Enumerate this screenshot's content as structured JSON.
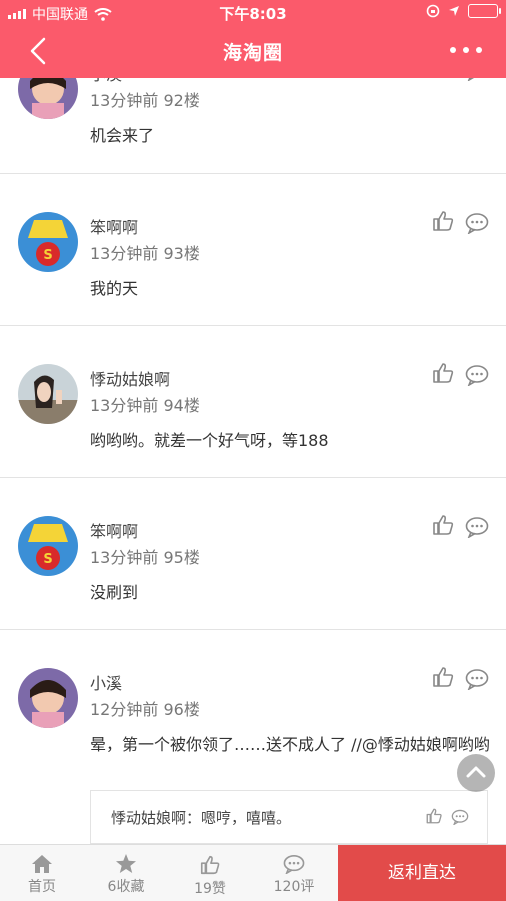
{
  "status_bar": {
    "carrier": "中国联通",
    "time": "下午8:03"
  },
  "nav": {
    "title": "海淘圈"
  },
  "colors": {
    "accent": "#fb5a6b",
    "rebate_button": "#e24b4a"
  },
  "comments": [
    {
      "user": "小溪",
      "time": "13分钟前",
      "floor": "92楼",
      "text": "机会来了",
      "avatar": "girl"
    },
    {
      "user": "笨啊啊",
      "time": "13分钟前",
      "floor": "93楼",
      "text": "我的天",
      "avatar": "superman"
    },
    {
      "user": "悸动姑娘啊",
      "time": "13分钟前",
      "floor": "94楼",
      "text": "哟哟哟。就差一个好气呀，等188",
      "avatar": "woman"
    },
    {
      "user": "笨啊啊",
      "time": "13分钟前",
      "floor": "95楼",
      "text": "没刷到",
      "avatar": "superman"
    },
    {
      "user": "小溪",
      "time": "12分钟前",
      "floor": "96楼",
      "text": "晕，第一个被你领了……送不成人了 //@悸动姑娘啊哟哟",
      "avatar": "girl",
      "reply": "悸动姑娘啊：嗯哼，嘻嘻。"
    }
  ],
  "bottom_bar": {
    "home": "首页",
    "favorites": "6收藏",
    "likes": "19赞",
    "comments": "120评",
    "rebate": "返利直达"
  },
  "icons": [
    "back-icon",
    "more-icon",
    "like-icon",
    "comment-icon",
    "scroll-top-icon",
    "home-icon",
    "star-icon",
    "thumb-icon",
    "chat-icon"
  ]
}
